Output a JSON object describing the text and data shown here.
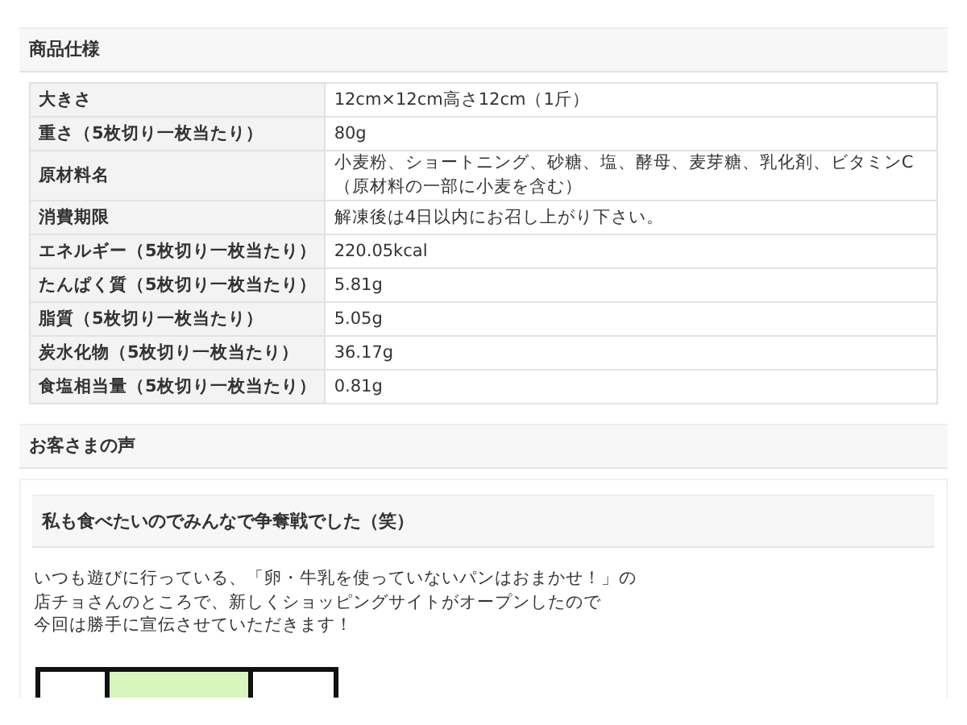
{
  "spec_section": {
    "heading": "商品仕様",
    "rows": [
      {
        "label": "大きさ",
        "value": "12cm×12cm高さ12cm（1斤）"
      },
      {
        "label": "重さ（5枚切り一枚当たり）",
        "value": "80g"
      },
      {
        "label": "原材料名",
        "value": "小麦粉、ショートニング、砂糖、塩、酵母、麦芽糖、乳化剤、ビタミンC（原材料の一部に小麦を含む）"
      },
      {
        "label": "消費期限",
        "value": "解凍後は4日以内にお召し上がり下さい。"
      },
      {
        "label": "エネルギー（5枚切り一枚当たり）",
        "value": "220.05kcal"
      },
      {
        "label": "たんぱく質（5枚切り一枚当たり）",
        "value": "5.81g"
      },
      {
        "label": "脂質（5枚切り一枚当たり）",
        "value": "5.05g"
      },
      {
        "label": "炭水化物（5枚切り一枚当たり）",
        "value": "36.17g"
      },
      {
        "label": "食塩相当量（5枚切り一枚当たり）",
        "value": "0.81g"
      }
    ]
  },
  "reviews_section": {
    "heading": "お客さまの声",
    "review": {
      "title": "私も食べたいのでみんなで争奪戦でした（笑）",
      "lines": [
        "いつも遊びに行っている、「卵・牛乳を使っていないパンはおまかせ！」の",
        "店チョさんのところで、新しくショッピングサイトがオープンしたので",
        "今回は勝手に宣伝させていただきます！"
      ]
    }
  }
}
